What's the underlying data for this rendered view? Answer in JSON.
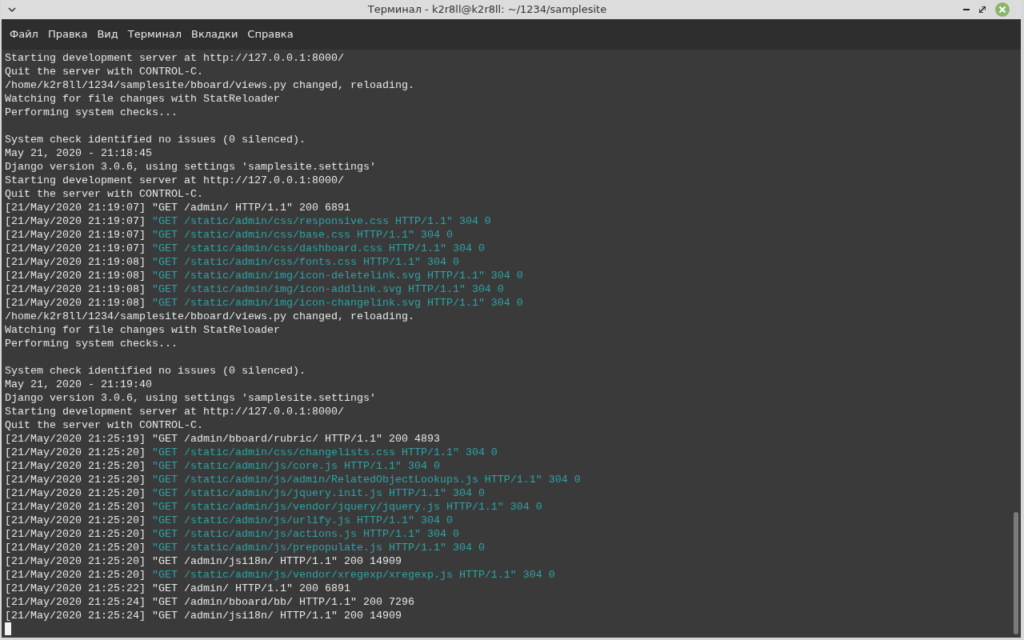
{
  "window": {
    "title": "Терминал - k2r8ll@k2r8ll: ~/1234/samplesite"
  },
  "menu": [
    "Файл",
    "Правка",
    "Вид",
    "Терминал",
    "Вкладки",
    "Справка"
  ],
  "lines": [
    {
      "kind": "text",
      "text": "Starting development server at http://127.0.0.1:8000/"
    },
    {
      "kind": "text",
      "text": "Quit the server with CONTROL-C."
    },
    {
      "kind": "text",
      "text": "/home/k2r8ll/1234/samplesite/bboard/views.py changed, reloading."
    },
    {
      "kind": "text",
      "text": "Watching for file changes with StatReloader"
    },
    {
      "kind": "text",
      "text": "Performing system checks..."
    },
    {
      "kind": "blank"
    },
    {
      "kind": "text",
      "text": "System check identified no issues (0 silenced)."
    },
    {
      "kind": "text",
      "text": "May 21, 2020 - 21:18:45"
    },
    {
      "kind": "text",
      "text": "Django version 3.0.6, using settings 'samplesite.settings'"
    },
    {
      "kind": "text",
      "text": "Starting development server at http://127.0.0.1:8000/"
    },
    {
      "kind": "text",
      "text": "Quit the server with CONTROL-C."
    },
    {
      "kind": "request",
      "time": "[21/May/2020 21:19:07]",
      "request": "\"GET /admin/ HTTP/1.1\" 200 6891",
      "cached": false
    },
    {
      "kind": "request",
      "time": "[21/May/2020 21:19:07]",
      "request": "\"GET /static/admin/css/responsive.css HTTP/1.1\" 304 0",
      "cached": true
    },
    {
      "kind": "request",
      "time": "[21/May/2020 21:19:07]",
      "request": "\"GET /static/admin/css/base.css HTTP/1.1\" 304 0",
      "cached": true
    },
    {
      "kind": "request",
      "time": "[21/May/2020 21:19:07]",
      "request": "\"GET /static/admin/css/dashboard.css HTTP/1.1\" 304 0",
      "cached": true
    },
    {
      "kind": "request",
      "time": "[21/May/2020 21:19:08]",
      "request": "\"GET /static/admin/css/fonts.css HTTP/1.1\" 304 0",
      "cached": true
    },
    {
      "kind": "request",
      "time": "[21/May/2020 21:19:08]",
      "request": "\"GET /static/admin/img/icon-deletelink.svg HTTP/1.1\" 304 0",
      "cached": true
    },
    {
      "kind": "request",
      "time": "[21/May/2020 21:19:08]",
      "request": "\"GET /static/admin/img/icon-addlink.svg HTTP/1.1\" 304 0",
      "cached": true
    },
    {
      "kind": "request",
      "time": "[21/May/2020 21:19:08]",
      "request": "\"GET /static/admin/img/icon-changelink.svg HTTP/1.1\" 304 0",
      "cached": true
    },
    {
      "kind": "text",
      "text": "/home/k2r8ll/1234/samplesite/bboard/views.py changed, reloading."
    },
    {
      "kind": "text",
      "text": "Watching for file changes with StatReloader"
    },
    {
      "kind": "text",
      "text": "Performing system checks..."
    },
    {
      "kind": "blank"
    },
    {
      "kind": "text",
      "text": "System check identified no issues (0 silenced)."
    },
    {
      "kind": "text",
      "text": "May 21, 2020 - 21:19:40"
    },
    {
      "kind": "text",
      "text": "Django version 3.0.6, using settings 'samplesite.settings'"
    },
    {
      "kind": "text",
      "text": "Starting development server at http://127.0.0.1:8000/"
    },
    {
      "kind": "text",
      "text": "Quit the server with CONTROL-C."
    },
    {
      "kind": "request",
      "time": "[21/May/2020 21:25:19]",
      "request": "\"GET /admin/bboard/rubric/ HTTP/1.1\" 200 4893",
      "cached": false
    },
    {
      "kind": "request",
      "time": "[21/May/2020 21:25:20]",
      "request": "\"GET /static/admin/css/changelists.css HTTP/1.1\" 304 0",
      "cached": true
    },
    {
      "kind": "request",
      "time": "[21/May/2020 21:25:20]",
      "request": "\"GET /static/admin/js/core.js HTTP/1.1\" 304 0",
      "cached": true
    },
    {
      "kind": "request",
      "time": "[21/May/2020 21:25:20]",
      "request": "\"GET /static/admin/js/admin/RelatedObjectLookups.js HTTP/1.1\" 304 0",
      "cached": true
    },
    {
      "kind": "request",
      "time": "[21/May/2020 21:25:20]",
      "request": "\"GET /static/admin/js/jquery.init.js HTTP/1.1\" 304 0",
      "cached": true
    },
    {
      "kind": "request",
      "time": "[21/May/2020 21:25:20]",
      "request": "\"GET /static/admin/js/vendor/jquery/jquery.js HTTP/1.1\" 304 0",
      "cached": true
    },
    {
      "kind": "request",
      "time": "[21/May/2020 21:25:20]",
      "request": "\"GET /static/admin/js/urlify.js HTTP/1.1\" 304 0",
      "cached": true
    },
    {
      "kind": "request",
      "time": "[21/May/2020 21:25:20]",
      "request": "\"GET /static/admin/js/actions.js HTTP/1.1\" 304 0",
      "cached": true
    },
    {
      "kind": "request",
      "time": "[21/May/2020 21:25:20]",
      "request": "\"GET /static/admin/js/prepopulate.js HTTP/1.1\" 304 0",
      "cached": true
    },
    {
      "kind": "request",
      "time": "[21/May/2020 21:25:20]",
      "request": "\"GET /admin/jsi18n/ HTTP/1.1\" 200 14909",
      "cached": false
    },
    {
      "kind": "request",
      "time": "[21/May/2020 21:25:20]",
      "request": "\"GET /static/admin/js/vendor/xregexp/xregexp.js HTTP/1.1\" 304 0",
      "cached": true
    },
    {
      "kind": "request",
      "time": "[21/May/2020 21:25:22]",
      "request": "\"GET /admin/ HTTP/1.1\" 200 6891",
      "cached": false
    },
    {
      "kind": "request",
      "time": "[21/May/2020 21:25:24]",
      "request": "\"GET /admin/bboard/bb/ HTTP/1.1\" 200 7296",
      "cached": false
    },
    {
      "kind": "request",
      "time": "[21/May/2020 21:25:24]",
      "request": "\"GET /admin/jsi18n/ HTTP/1.1\" 200 14909",
      "cached": false
    },
    {
      "kind": "cursor"
    }
  ]
}
